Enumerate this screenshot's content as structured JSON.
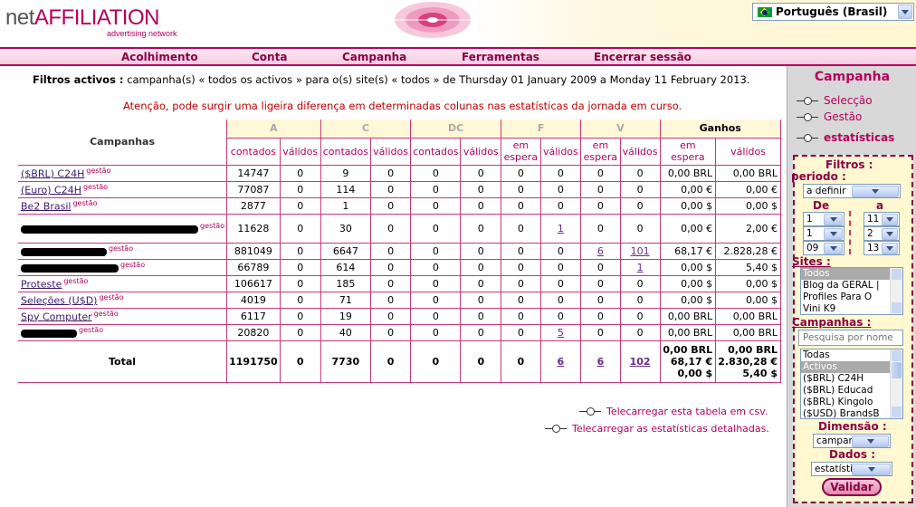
{
  "header": {
    "brand_prefix": "net",
    "brand_suffix": "AFFILIATION",
    "tagline": "advertising network",
    "language": "Português (Brasil)"
  },
  "nav": [
    "Acolhimento",
    "Conta",
    "Campanha",
    "Ferramentas",
    "Encerrar sessão"
  ],
  "filters": {
    "label": "Filtros activos :",
    "text": "campanha(s) « todos os activos » para o(s) site(s) « todos » de Thursday 01 January 2009 a Monday 11 February 2013."
  },
  "warning": "Atenção, pode surgir uma ligeira diferença em determinadas colunas nas estatísticas da jornada em curso.",
  "table": {
    "campaign_header": "Campanhas",
    "groups": [
      "A",
      "C",
      "DC",
      "F",
      "V",
      "Ganhos"
    ],
    "subheaders": [
      "contados",
      "válidos",
      "contados",
      "válidos",
      "contados",
      "válidos",
      "em espera",
      "válidos",
      "em espera",
      "válidos",
      "em espera",
      "válidos"
    ],
    "gestao": "gestão",
    "rows": [
      {
        "name": "($BRL) C24H",
        "cells": [
          "14747",
          "0",
          "9",
          "0",
          "0",
          "0",
          "0",
          "0",
          "0",
          "0",
          "0,00 BRL",
          "0,00 BRL"
        ]
      },
      {
        "name": "(Euro) C24H",
        "cells": [
          "77087",
          "0",
          "114",
          "0",
          "0",
          "0",
          "0",
          "0",
          "0",
          "0",
          "0,00 €",
          "0,00 €"
        ]
      },
      {
        "name": "Be2 Brasil",
        "cells": [
          "2877",
          "0",
          "1",
          "0",
          "0",
          "0",
          "0",
          "0",
          "0",
          "0",
          "0,00 $",
          "0,00 $"
        ]
      },
      {
        "name": "",
        "cells": [
          "11628",
          "0",
          "30",
          "0",
          "0",
          "0",
          "0",
          "1",
          "0",
          "0",
          "0,00 €",
          "2,00 €"
        ]
      },
      {
        "name": "",
        "cells": [
          "881049",
          "0",
          "6647",
          "0",
          "0",
          "0",
          "0",
          "0",
          "6",
          "101",
          "68,17 €",
          "2.828,28 €"
        ]
      },
      {
        "name": "",
        "cells": [
          "66789",
          "0",
          "614",
          "0",
          "0",
          "0",
          "0",
          "0",
          "0",
          "1",
          "0,00 $",
          "5,40 $"
        ]
      },
      {
        "name": "Proteste",
        "cells": [
          "106617",
          "0",
          "185",
          "0",
          "0",
          "0",
          "0",
          "0",
          "0",
          "0",
          "0,00 $",
          "0,00 $"
        ]
      },
      {
        "name": "Seleções (U$D)",
        "cells": [
          "4019",
          "0",
          "71",
          "0",
          "0",
          "0",
          "0",
          "0",
          "0",
          "0",
          "0,00 $",
          "0,00 $"
        ]
      },
      {
        "name": "Spy Computer",
        "cells": [
          "6117",
          "0",
          "19",
          "0",
          "0",
          "0",
          "0",
          "0",
          "0",
          "0",
          "0,00 BRL",
          "0,00 BRL"
        ]
      },
      {
        "name": "",
        "cells": [
          "20820",
          "0",
          "40",
          "0",
          "0",
          "0",
          "0",
          "5",
          "0",
          "0",
          "0,00 BRL",
          "0,00 BRL"
        ]
      }
    ],
    "total": {
      "label": "Total",
      "cells": [
        "1191750",
        "0",
        "7730",
        "0",
        "0",
        "0",
        "0",
        "6",
        "6",
        "102"
      ],
      "ganhos_espera": [
        "0,00 BRL",
        "68,17 €",
        "0,00 $"
      ],
      "ganhos_validos": [
        "0,00 BRL",
        "2.830,28 €",
        "5,40 $"
      ]
    }
  },
  "links": {
    "csv": "Telecarregar esta tabela em csv.",
    "detailed": "Telecarregar as estatísticas detalhadas."
  },
  "sidebar": {
    "title": "Campanha",
    "links": [
      "Selecção",
      "Gestão",
      "estatísticas"
    ],
    "filters_label": "Filtros :",
    "periodo_label": "periodo :",
    "periodo_value": "a definir",
    "de_label": "De",
    "a_label": "a",
    "de_values": [
      "1",
      "1",
      "09"
    ],
    "a_values": [
      "11",
      "2",
      "13"
    ],
    "sites_label": "Sites :",
    "sites_options": [
      "Todos",
      "Blog da GERAL |",
      "Profiles Para O",
      "Vini K9"
    ],
    "campanhas_label": "Campanhas :",
    "search_placeholder": "Pesquisa por nome",
    "campanhas_options": [
      "Todas",
      "Activos",
      "($BRL) C24H",
      "($BRL) Educad",
      "($BRL) Kingolo",
      "($USD) BrandsB"
    ],
    "dimensao_label": "Dimensão :",
    "dimensao_value": "campanha",
    "dados_label": "Dados :",
    "dados_value": "estatísticas",
    "validar": "Validar"
  }
}
